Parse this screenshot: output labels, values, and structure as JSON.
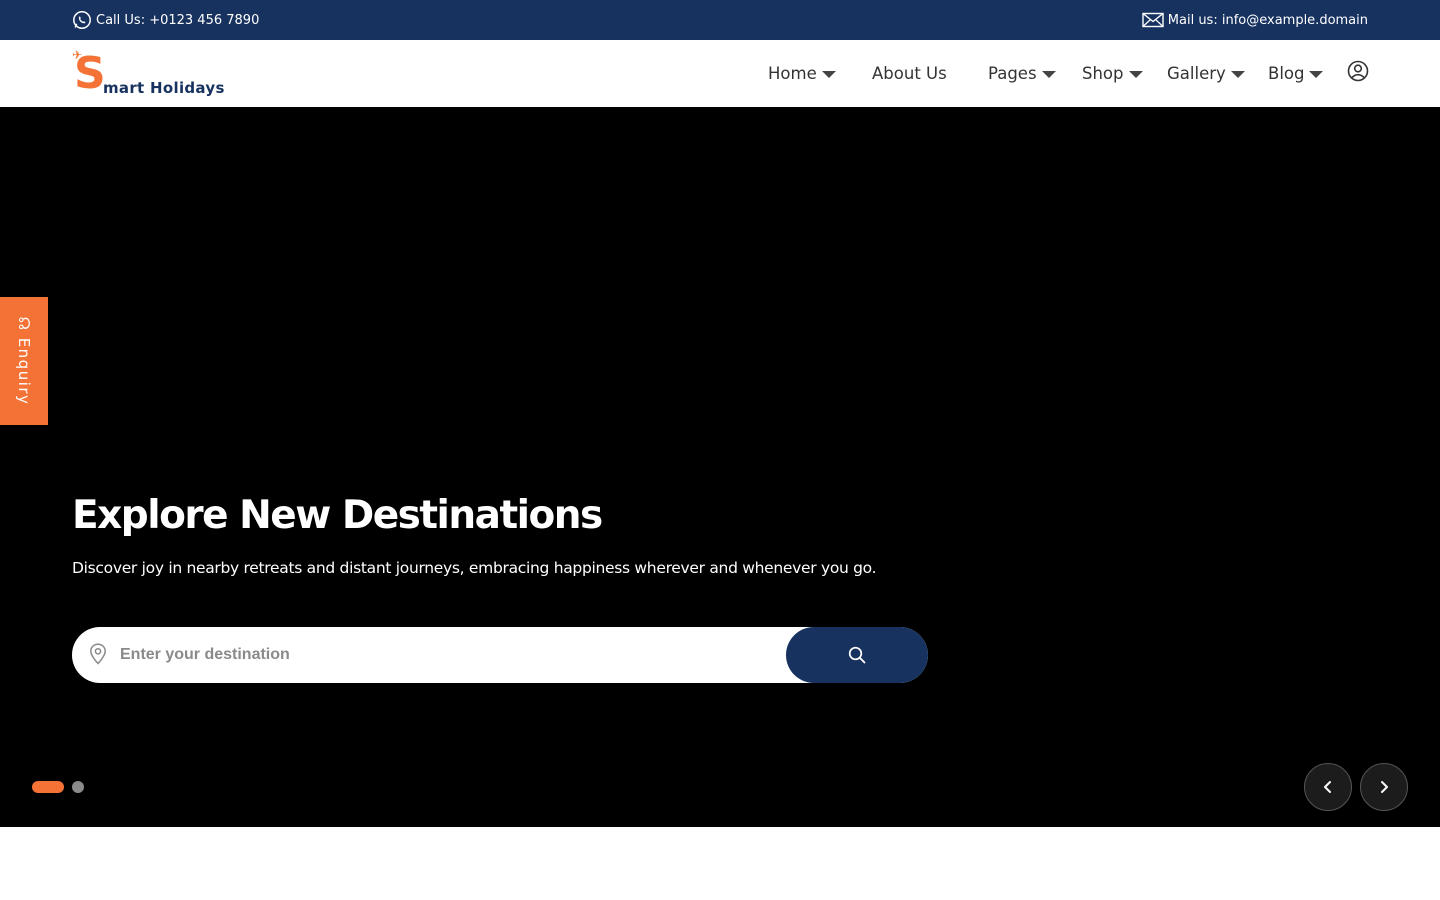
{
  "topbar": {
    "call": "Call Us: +0123 456 7890",
    "mail": "Mail us: info@example.domain",
    "call_icon": "whatsapp-icon",
    "mail_icon": "envelope-icon"
  },
  "brand": {
    "name": "mart Holidays",
    "initial": "S",
    "colors": {
      "primary": "#17325f",
      "accent": "#f47236"
    }
  },
  "nav": {
    "items": [
      {
        "label": "Home",
        "dropdown": true
      },
      {
        "label": "About Us",
        "dropdown": false
      },
      {
        "label": "Pages",
        "dropdown": true
      },
      {
        "label": "Shop",
        "dropdown": true
      },
      {
        "label": "Gallery",
        "dropdown": true
      },
      {
        "label": "Blog",
        "dropdown": true
      }
    ],
    "user_icon": "user-circle-icon"
  },
  "enquiry": {
    "label": "Enquiry"
  },
  "hero": {
    "title": "Explore New Destinations",
    "subtitle": "Discover joy in nearby retreats and distant journeys, embracing happiness wherever and whenever you go.",
    "search": {
      "placeholder": "Enter your destination",
      "value": ""
    }
  },
  "slider": {
    "slides": 2,
    "active_index": 0
  }
}
